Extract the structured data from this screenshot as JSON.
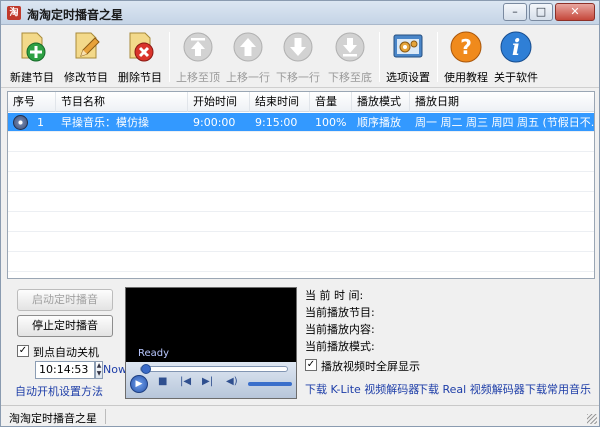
{
  "window": {
    "title": "淘淘定时播音之星",
    "min": "–",
    "max": "□",
    "close": "✕"
  },
  "toolbar": {
    "new": "新建节目",
    "edit": "修改节目",
    "delete": "删除节目",
    "move_top": "上移至顶",
    "move_up": "上移一行",
    "move_down": "下移一行",
    "move_bottom": "下移至底",
    "options": "选项设置",
    "tutorial": "使用教程",
    "about": "关于软件"
  },
  "table": {
    "headers": [
      "序号",
      "节目名称",
      "开始时间",
      "结束时间",
      "音量",
      "播放模式",
      "播放日期"
    ],
    "rows": [
      [
        "1",
        "早操音乐：模仿操",
        "9:00:00",
        "9:15:00",
        "100%",
        "顺序播放",
        "周一 周二 周三 周四 周五 (节假日不..."
      ]
    ]
  },
  "controls": {
    "start_button": "启动定时播音",
    "stop_button": "停止定时播音",
    "auto_shutdown_label": "到点自动关机",
    "auto_shutdown_checked": "✓",
    "shutdown_time": "10:14:53",
    "now_label": "Now",
    "autostart_link": "自动开机设置方法"
  },
  "player": {
    "status": "Ready",
    "play": "▶",
    "stop": "■",
    "prev": "|◀",
    "next": "▶|",
    "volume": "◀)"
  },
  "info": {
    "current_time": "当 前 时 间:",
    "current_program": "当前播放节目:",
    "current_content": "当前播放内容:",
    "current_mode": "当前播放模式:",
    "fullscreen_label": "播放视频时全屏显示",
    "fullscreen_checked": "✓"
  },
  "links": {
    "klite": "下载 K-Lite 视频解码器",
    "real": "下载 Real 视频解码器",
    "music": "下载常用音乐"
  },
  "statusbar": {
    "text": "淘淘定时播音之星"
  }
}
